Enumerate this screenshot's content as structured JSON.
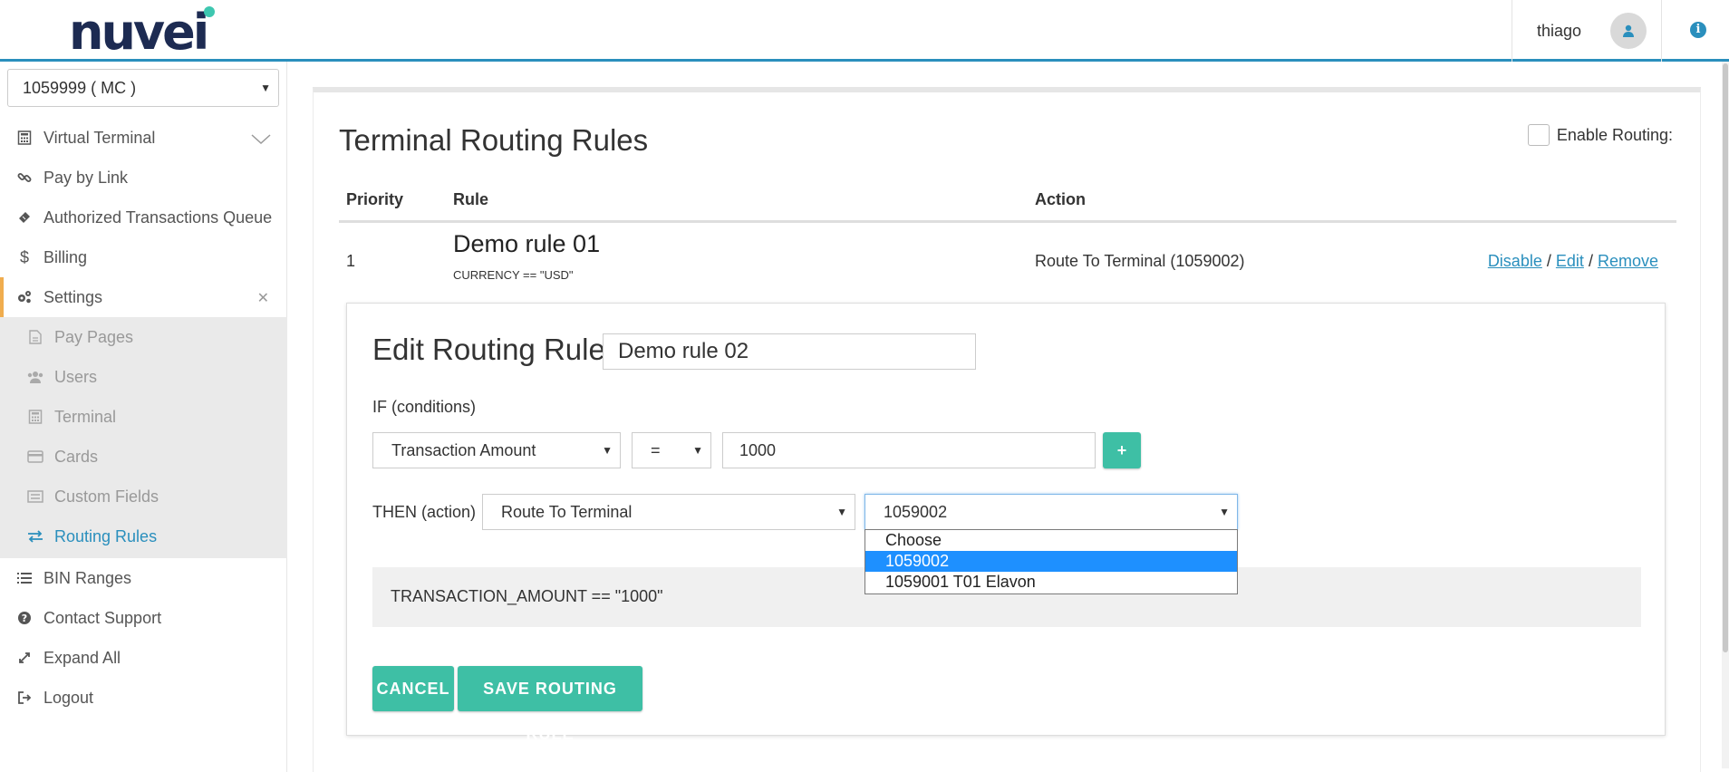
{
  "brand": {
    "logo_text": "nuvei",
    "accent": "#3ebfa5",
    "primary": "#2a8fbd",
    "logo_color": "#1d2b52"
  },
  "header": {
    "user_name": "thiago",
    "avatar_icon": "user-icon",
    "info_icon": "info-icon"
  },
  "sidebar": {
    "merchant": "1059999 ( MC )",
    "items": [
      {
        "label": "Virtual Terminal",
        "icon": "calculator-icon"
      },
      {
        "label": "Pay by Link",
        "icon": "link-icon"
      },
      {
        "label": "Authorized Transactions Queue",
        "icon": "ticket-icon"
      },
      {
        "label": "Billing",
        "icon": "dollar-icon"
      },
      {
        "label": "Settings",
        "icon": "gears-icon"
      },
      {
        "label": "BIN Ranges",
        "icon": "list-icon"
      },
      {
        "label": "Contact Support",
        "icon": "question-icon"
      },
      {
        "label": "Expand All",
        "icon": "expand-icon"
      },
      {
        "label": "Logout",
        "icon": "logout-icon"
      }
    ],
    "settings_sub": [
      {
        "label": "Pay Pages",
        "icon": "file-icon"
      },
      {
        "label": "Users",
        "icon": "users-icon"
      },
      {
        "label": "Terminal",
        "icon": "calculator-icon"
      },
      {
        "label": "Cards",
        "icon": "card-icon"
      },
      {
        "label": "Custom Fields",
        "icon": "fields-icon"
      },
      {
        "label": "Routing Rules",
        "icon": "exchange-icon"
      }
    ]
  },
  "main": {
    "title": "Terminal Routing Rules",
    "enable_routing": "Enable Routing:",
    "table": {
      "headers": {
        "priority": "Priority",
        "rule": "Rule",
        "action": "Action"
      },
      "rows": [
        {
          "priority": "1",
          "name": "Demo rule 01",
          "condition": "CURRENCY == \"USD\"",
          "action": "Route To Terminal (1059002)",
          "links": {
            "disable": "Disable",
            "edit": "Edit",
            "remove": "Remove",
            "sep": "/"
          }
        }
      ]
    },
    "edit": {
      "title": "Edit Routing Rule",
      "name_value": "Demo rule 02",
      "if_label": "IF (conditions)",
      "field": "Transaction Amount",
      "operator": "=",
      "value": "1000",
      "plus": "+",
      "then_label": "THEN (action)",
      "action": "Route To Terminal",
      "terminal": "1059002",
      "terminal_options": [
        "Choose",
        "1059002",
        "1059001 T01 Elavon"
      ],
      "expression": "TRANSACTION_AMOUNT == \"1000\"",
      "cancel": "CANCEL",
      "save": "SAVE ROUTING RULE"
    }
  }
}
